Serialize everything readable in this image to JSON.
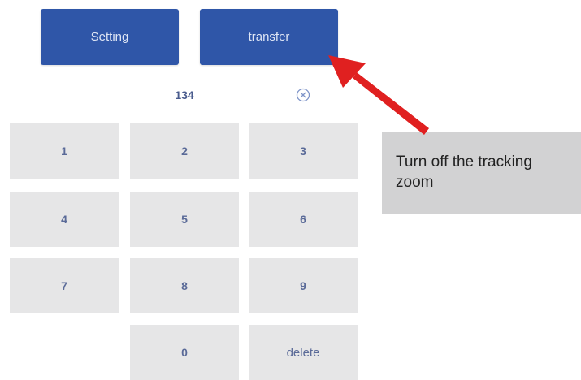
{
  "header": {
    "setting_label": "Setting",
    "transfer_label": "transfer"
  },
  "display": {
    "value": "134"
  },
  "keypad": {
    "keys": [
      "1",
      "2",
      "3",
      "4",
      "5",
      "6",
      "7",
      "8",
      "9",
      "0"
    ],
    "delete_label": "delete"
  },
  "annotation": {
    "line1": "Turn off the tracking",
    "line2": "zoom"
  },
  "colors": {
    "primary_button": "#2f56a8",
    "key_background": "#e6e6e7",
    "arrow": "#e02020",
    "annotation_background": "#d2d2d3"
  },
  "icons": {
    "clear": "circle-x-icon",
    "pointer": "arrow-icon"
  }
}
